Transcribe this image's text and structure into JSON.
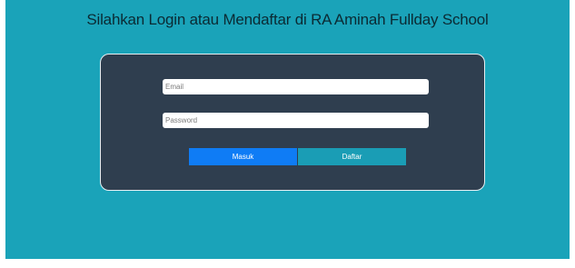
{
  "header": {
    "title": "Silahkan Login atau Mendaftar di RA Aminah Fullday School"
  },
  "login_form": {
    "email_placeholder": "Email",
    "email_value": "",
    "password_placeholder": "Password",
    "password_value": "",
    "masuk_label": "Masuk",
    "daftar_label": "Daftar"
  },
  "colors": {
    "background": "#1aa3b9",
    "card": "#2f3e4f",
    "primary_button": "#0f7cf5",
    "secondary_button": "#1a9db5"
  }
}
